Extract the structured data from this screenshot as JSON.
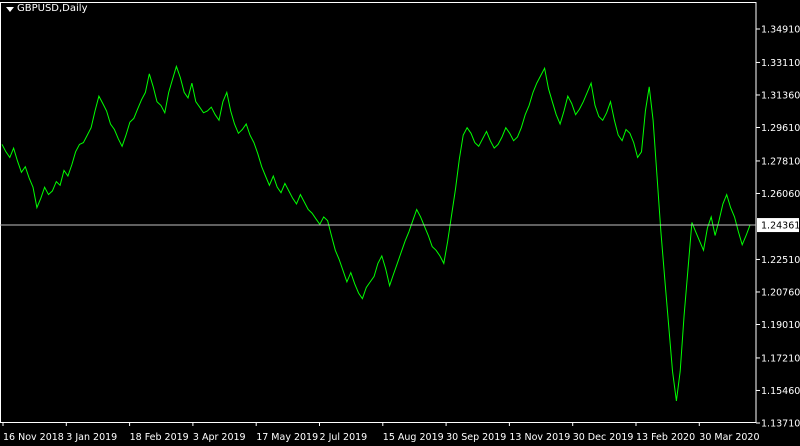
{
  "window": {
    "symbol_title": "GBPUSD,Daily"
  },
  "colors": {
    "background": "#000000",
    "line": "#00ff00",
    "axis": "#ffffff",
    "bid_line": "#c0c0c0",
    "bid_box": "#ffffff",
    "bid_text": "#000000"
  },
  "chart_data": {
    "type": "line",
    "title": "GBPUSD,Daily",
    "xlabel": "",
    "ylabel": "",
    "ylim": [
      1.1371,
      1.3491
    ],
    "y_ticks": [
      "1.34910",
      "1.33110",
      "1.31360",
      "1.29610",
      "1.27810",
      "1.26060",
      "1.24361",
      "1.22510",
      "1.20760",
      "1.19010",
      "1.17210",
      "1.15460",
      "1.13710"
    ],
    "current_price": "1.24361",
    "x_ticks": [
      "16 Nov 2018",
      "3 Jan 2019",
      "18 Feb 2019",
      "3 Apr 2019",
      "17 May 2019",
      "2 Jul 2019",
      "15 Aug 2019",
      "30 Sep 2019",
      "13 Nov 2019",
      "30 Dec 2019",
      "13 Feb 2020",
      "30 Mar 2020"
    ],
    "grid": false,
    "series": [
      {
        "values": [
          1.287,
          1.283,
          1.28,
          1.285,
          1.278,
          1.272,
          1.275,
          1.269,
          1.264,
          1.253,
          1.258,
          1.264,
          1.26,
          1.262,
          1.267,
          1.265,
          1.273,
          1.27,
          1.276,
          1.283,
          1.287,
          1.288,
          1.292,
          1.296,
          1.305,
          1.313,
          1.309,
          1.305,
          1.298,
          1.295,
          1.29,
          1.286,
          1.292,
          1.299,
          1.301,
          1.306,
          1.311,
          1.315,
          1.325,
          1.318,
          1.31,
          1.308,
          1.304,
          1.315,
          1.322,
          1.329,
          1.323,
          1.315,
          1.312,
          1.32,
          1.31,
          1.307,
          1.304,
          1.305,
          1.307,
          1.303,
          1.3,
          1.31,
          1.315,
          1.305,
          1.298,
          1.293,
          1.295,
          1.298,
          1.292,
          1.288,
          1.282,
          1.275,
          1.27,
          1.265,
          1.27,
          1.264,
          1.261,
          1.266,
          1.262,
          1.258,
          1.255,
          1.26,
          1.256,
          1.252,
          1.25,
          1.247,
          1.244,
          1.248,
          1.246,
          1.238,
          1.23,
          1.225,
          1.219,
          1.213,
          1.218,
          1.212,
          1.207,
          1.204,
          1.21,
          1.213,
          1.216,
          1.223,
          1.227,
          1.22,
          1.211,
          1.217,
          1.223,
          1.229,
          1.235,
          1.24,
          1.246,
          1.252,
          1.248,
          1.243,
          1.238,
          1.232,
          1.23,
          1.227,
          1.223,
          1.235,
          1.249,
          1.263,
          1.279,
          1.292,
          1.296,
          1.293,
          1.288,
          1.286,
          1.29,
          1.294,
          1.289,
          1.285,
          1.287,
          1.291,
          1.296,
          1.293,
          1.289,
          1.291,
          1.296,
          1.303,
          1.308,
          1.315,
          1.32,
          1.324,
          1.328,
          1.317,
          1.31,
          1.303,
          1.298,
          1.305,
          1.313,
          1.309,
          1.303,
          1.306,
          1.31,
          1.315,
          1.32,
          1.308,
          1.302,
          1.3,
          1.304,
          1.31,
          1.3,
          1.292,
          1.289,
          1.295,
          1.293,
          1.288,
          1.28,
          1.283,
          1.305,
          1.318,
          1.3,
          1.27,
          1.24,
          1.215,
          1.19,
          1.165,
          1.149,
          1.165,
          1.195,
          1.22,
          1.245,
          1.24,
          1.235,
          1.23,
          1.242,
          1.248,
          1.238,
          1.246,
          1.255,
          1.26,
          1.253,
          1.248,
          1.24,
          1.233,
          1.238,
          1.2436
        ]
      }
    ]
  }
}
